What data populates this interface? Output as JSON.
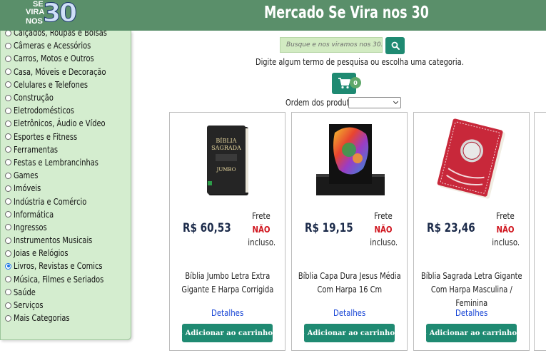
{
  "header": {
    "logo_se": "SE",
    "logo_vira": "VIRA",
    "logo_nos": "NOS",
    "logo_30": "30",
    "title": "Mercado Se Vira nos 30",
    "bg_color": "#5a8f6a"
  },
  "sidebar": {
    "bg_color": "#d4edcf",
    "categories": [
      {
        "label": "Calçados, Roupas e Bolsas",
        "checked": false
      },
      {
        "label": "Câmeras e Acessórios",
        "checked": false
      },
      {
        "label": "Carros, Motos e Outros",
        "checked": false
      },
      {
        "label": "Casa, Móveis e Decoração",
        "checked": false
      },
      {
        "label": "Celulares e Telefones",
        "checked": false
      },
      {
        "label": "Construção",
        "checked": false
      },
      {
        "label": "Eletrodomésticos",
        "checked": false
      },
      {
        "label": "Eletrônicos, Áudio e Vídeo",
        "checked": false
      },
      {
        "label": "Esportes e Fitness",
        "checked": false
      },
      {
        "label": "Ferramentas",
        "checked": false
      },
      {
        "label": "Festas e Lembrancinhas",
        "checked": false
      },
      {
        "label": "Games",
        "checked": false
      },
      {
        "label": "Imóveis",
        "checked": false
      },
      {
        "label": "Indústria e Comércio",
        "checked": false
      },
      {
        "label": "Informática",
        "checked": false
      },
      {
        "label": "Ingressos",
        "checked": false
      },
      {
        "label": "Instrumentos Musicais",
        "checked": false
      },
      {
        "label": "Joias e Relógios",
        "checked": false
      },
      {
        "label": "Livros, Revistas e Comics",
        "checked": true
      },
      {
        "label": "Música, Filmes e Seriados",
        "checked": false
      },
      {
        "label": "Saúde",
        "checked": false
      },
      {
        "label": "Serviços",
        "checked": false
      },
      {
        "label": "Mais Categorias",
        "checked": false
      }
    ]
  },
  "search": {
    "placeholder": "Busque e nos viramos nos 30...",
    "value": "",
    "icon": "search-icon"
  },
  "hint": "Digite algum termo de pesquisa ou escolha uma categoria.",
  "cart": {
    "icon": "cart-icon",
    "count": "0"
  },
  "sort": {
    "label": "Ordem dos produtos:",
    "selected": ""
  },
  "products": [
    {
      "price": "R$ 60,53",
      "frete_label": "Frete",
      "frete_status": "NÃO",
      "frete_suffix": "incluso.",
      "name": "Bíblia Jumbo Letra Extra Gigante E Harpa Corrigida",
      "details_label": "Detalhes",
      "add_label": "Adicionar ao carrinho",
      "cover_title_1": "BÍBLIA",
      "cover_title_2": "SAGRADA",
      "cover_title_3": "JUMBO",
      "image": "black-bible-cover"
    },
    {
      "price": "R$ 19,15",
      "frete_label": "Frete",
      "frete_status": "NÃO",
      "frete_suffix": "incluso.",
      "name": "Bíblia Capa Dura Jesus Média Com Harpa 16 Cm",
      "details_label": "Detalhes",
      "add_label": "Adicionar ao carrinho",
      "image": "colorful-lion-bible-cover"
    },
    {
      "price": "R$ 23,46",
      "frete_label": "Frete",
      "frete_status": "NÃO",
      "frete_suffix": "incluso.",
      "name": "Bíblia Sagrada Letra Gigante Com Harpa Masculina / Feminina",
      "details_label": "Detalhes",
      "add_label": "Adicionar ao carrinho",
      "image": "red-ornate-bible-cover"
    }
  ],
  "colors": {
    "accent": "#1f8a72",
    "price": "#1c2b4a",
    "frete_no": "#d0141d",
    "link": "#1a47d6"
  }
}
